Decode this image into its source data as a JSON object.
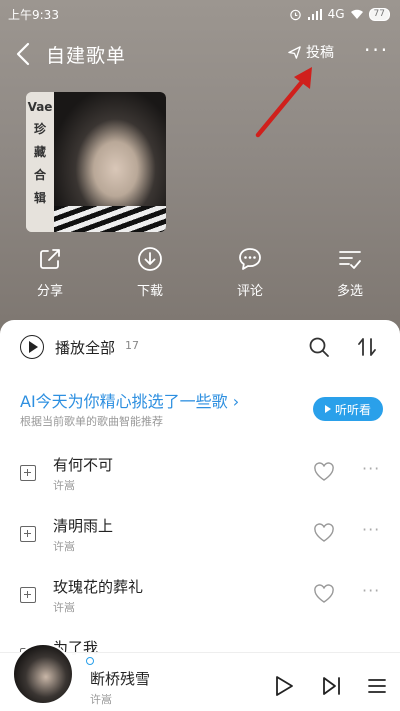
{
  "status": {
    "time": "上午9:33",
    "network": "4G",
    "battery": "77"
  },
  "header": {
    "title": "自建歌单",
    "submit_label": "投稿"
  },
  "cover": {
    "strip_text": [
      "Vae",
      "珍",
      "藏",
      "合",
      "辑"
    ]
  },
  "actions": [
    {
      "label": "分享",
      "icon": "share-icon"
    },
    {
      "label": "下载",
      "icon": "download-icon"
    },
    {
      "label": "评论",
      "icon": "comment-icon"
    },
    {
      "label": "多选",
      "icon": "multi-select-icon"
    }
  ],
  "list_header": {
    "play_all_label": "播放全部",
    "count": "17"
  },
  "ai_banner": {
    "title": "AI今天为你精心挑选了一些歌",
    "subtitle": "根据当前歌单的歌曲智能推荐",
    "button_label": "听听看"
  },
  "songs": [
    {
      "title": "有何不可",
      "artist": "许嵩"
    },
    {
      "title": "清明雨上",
      "artist": "许嵩"
    },
    {
      "title": "玫瑰花的葬礼",
      "artist": "许嵩"
    },
    {
      "title": "为了我",
      "artist": ""
    }
  ],
  "now_playing": {
    "title": "断桥残雪",
    "artist": "许嵩"
  },
  "colors": {
    "accent": "#2aa0ea",
    "ai_text": "#2d8fe0",
    "annotation_arrow": "#d0201c"
  }
}
